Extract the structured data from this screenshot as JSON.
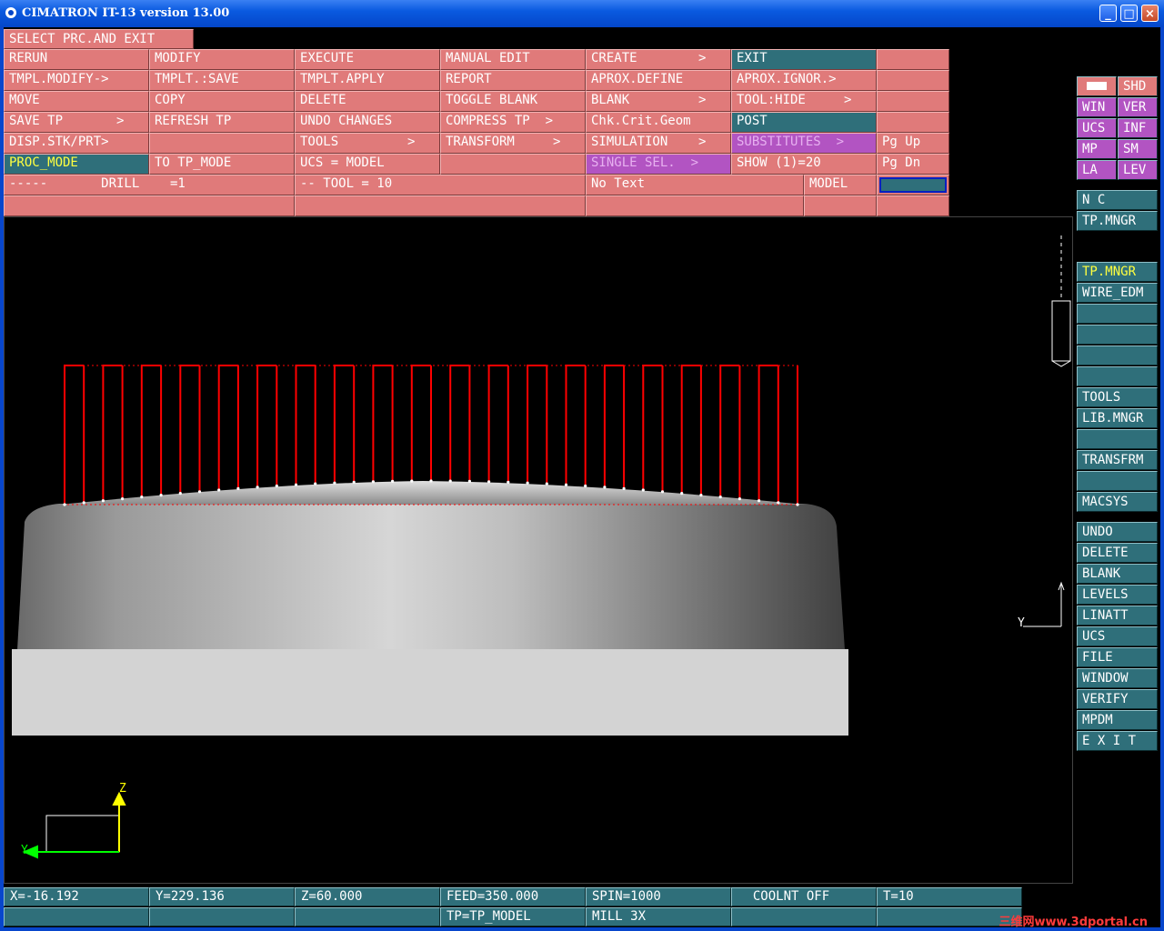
{
  "window": {
    "title": "CIMATRON IT-13 version 13.00",
    "min": "_",
    "max": "□",
    "close": "×"
  },
  "prompt": "SELECT PRC.AND EXIT",
  "menu": {
    "r1": [
      "RERUN",
      "MODIFY",
      "EXECUTE",
      "MANUAL EDIT",
      "CREATE        >",
      "EXIT",
      ""
    ],
    "r2": [
      "TMPL.MODIFY->",
      "TMPLT.:SAVE",
      "TMPLT.APPLY",
      "REPORT",
      "APROX.DEFINE",
      "APROX.IGNOR.>",
      ""
    ],
    "r3": [
      "MOVE",
      "COPY",
      "DELETE",
      "TOGGLE BLANK",
      "BLANK         >",
      "TOOL:HIDE     >",
      ""
    ],
    "r4": [
      "SAVE TP       >",
      "REFRESH TP",
      "UNDO CHANGES",
      "COMPRESS TP  >",
      "Chk.Crit.Geom",
      "POST",
      ""
    ],
    "r5": [
      "DISP.STK/PRT>",
      "",
      "TOOLS         >",
      "TRANSFORM     >",
      "SIMULATION    >",
      "SUBSTITUTES  >",
      "Pg Up"
    ],
    "r6": [
      "PROC_MODE",
      "TO TP_MODE",
      "UCS = MODEL",
      "",
      "SINGLE SEL.  >",
      "SHOW (1)=20",
      "Pg Dn"
    ],
    "r7": [
      "-----       DRILL    =1",
      "-- TOOL = 10",
      "No Text",
      "MODEL",
      ""
    ]
  },
  "side": {
    "view": [
      "",
      "SHD",
      "WIN",
      "VER",
      "UCS",
      "INF",
      "MP",
      "SM",
      "LA",
      "LEV"
    ],
    "nc": [
      "N C",
      "TP.MNGR"
    ],
    "mid": [
      "TP.MNGR",
      "WIRE_EDM",
      "",
      "",
      "",
      "",
      "TOOLS",
      "LIB.MNGR",
      "",
      "TRANSFRM",
      "",
      "MACSYS"
    ],
    "bottom": [
      "UNDO",
      "DELETE",
      "BLANK",
      "LEVELS",
      "LINATT",
      "UCS",
      "FILE",
      "WINDOW",
      "VERIFY",
      "MPDM",
      "E X I T"
    ]
  },
  "viewport": {
    "axis_z": "Z",
    "axis_y": "Y",
    "axis_y2": "Y",
    "drill_count": 39
  },
  "status": {
    "r1": [
      "X=-16.192",
      "Y=229.136",
      "Z=60.000",
      "FEED=350.000",
      "SPIN=1000",
      "  COOLNT OFF",
      "T=10"
    ],
    "r2": [
      "",
      "",
      "",
      "TP=TP_MODEL",
      "MILL 3X",
      "",
      ""
    ]
  },
  "watermark": "三维网www.3dportal.cn",
  "colors": {
    "menu": "#e07a7a",
    "active": "#2f6f7a",
    "purple": "#b254c2",
    "toolpath": "#ff0000"
  }
}
